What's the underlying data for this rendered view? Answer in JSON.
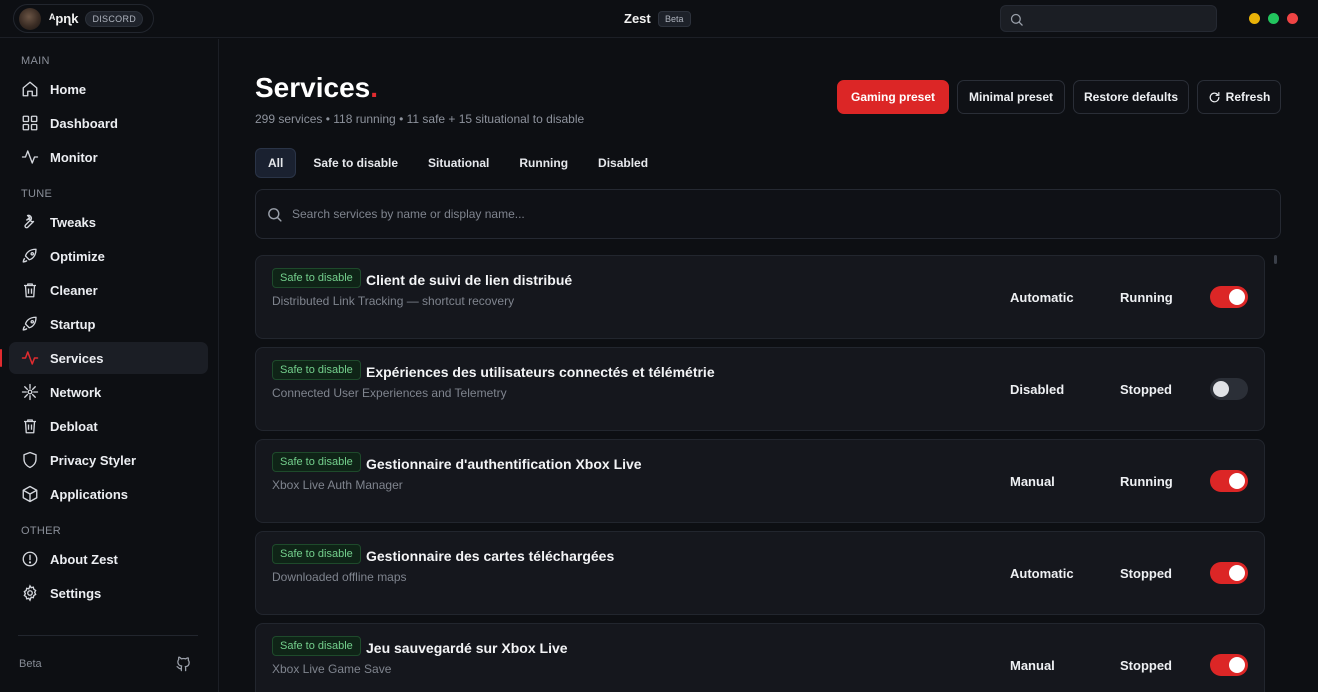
{
  "titlebar": {
    "username": "ᴬpɳk",
    "discord_badge": "DISCORD",
    "app_title": "Zest",
    "beta_badge": "Beta",
    "window_dots": [
      "#eab308",
      "#22c55e",
      "#ef4444"
    ]
  },
  "sidebar": {
    "sections": {
      "main": "MAIN",
      "tune": "TUNE",
      "other": "OTHER"
    },
    "items": [
      {
        "label": "Home",
        "icon": "home-icon"
      },
      {
        "label": "Dashboard",
        "icon": "dashboard-icon"
      },
      {
        "label": "Monitor",
        "icon": "activity-icon"
      },
      {
        "label": "Tweaks",
        "icon": "wrench-icon"
      },
      {
        "label": "Optimize",
        "icon": "rocket-icon"
      },
      {
        "label": "Cleaner",
        "icon": "trash-icon"
      },
      {
        "label": "Startup",
        "icon": "rocket-icon"
      },
      {
        "label": "Services",
        "icon": "activity-icon",
        "active": true
      },
      {
        "label": "Network",
        "icon": "network-icon"
      },
      {
        "label": "Debloat",
        "icon": "trash-icon"
      },
      {
        "label": "Privacy Styler",
        "icon": "shield-icon"
      },
      {
        "label": "Applications",
        "icon": "package-icon"
      },
      {
        "label": "About Zest",
        "icon": "info-icon"
      },
      {
        "label": "Settings",
        "icon": "gear-icon"
      }
    ],
    "footer_label": "Beta"
  },
  "main": {
    "title": "Services",
    "title_dot": ".",
    "subtitle": "299 services • 118 running • 11 safe + 15 situational to disable",
    "buttons": {
      "gaming": "Gaming preset",
      "minimal": "Minimal preset",
      "restore": "Restore defaults",
      "refresh": "Refresh"
    },
    "tabs": [
      "All",
      "Safe to disable",
      "Situational",
      "Running",
      "Disabled"
    ],
    "active_tab": "All",
    "search_placeholder": "Search services by name or display name...",
    "accent_color": "#dc2626",
    "services": [
      {
        "badge": "Safe to disable",
        "name": "Client de suivi de lien distribué",
        "desc": "Distributed Link Tracking — shortcut recovery",
        "startup": "Automatic",
        "status": "Running",
        "enabled": true
      },
      {
        "badge": "Safe to disable",
        "name": "Expériences des utilisateurs connectés et télémétrie",
        "desc": "Connected User Experiences and Telemetry",
        "startup": "Disabled",
        "status": "Stopped",
        "enabled": false
      },
      {
        "badge": "Safe to disable",
        "name": "Gestionnaire d'authentification Xbox Live",
        "desc": "Xbox Live Auth Manager",
        "startup": "Manual",
        "status": "Running",
        "enabled": true
      },
      {
        "badge": "Safe to disable",
        "name": "Gestionnaire des cartes téléchargées",
        "desc": "Downloaded offline maps",
        "startup": "Automatic",
        "status": "Stopped",
        "enabled": true
      },
      {
        "badge": "Safe to disable",
        "name": "Jeu sauvegardé sur Xbox Live",
        "desc": "Xbox Live Game Save",
        "startup": "Manual",
        "status": "Stopped",
        "enabled": true
      }
    ]
  }
}
